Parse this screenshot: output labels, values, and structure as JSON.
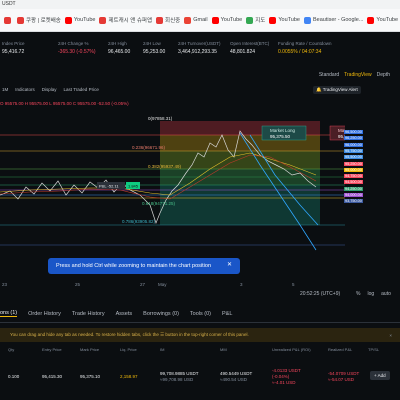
{
  "browser": {
    "tab_title": "USDT",
    "bookmarks": [
      {
        "label": "",
        "icon": "red-square-icon",
        "color": "#e53935"
      },
      {
        "label": "쿠팡 | 로켓배송",
        "icon": "coupang-icon",
        "color": "#e53935"
      },
      {
        "label": "YouTube",
        "icon": "youtube-icon",
        "color": "#ff0000"
      },
      {
        "label": "제트캐시 앤 슈퍼앱",
        "icon": "zcash-icon",
        "color": "#e53935"
      },
      {
        "label": "회신중",
        "icon": "message-icon",
        "color": "#e53935"
      },
      {
        "label": "Gmail",
        "icon": "gmail-icon",
        "color": "#ea4335"
      },
      {
        "label": "YouTube",
        "icon": "youtube-icon",
        "color": "#ff0000"
      },
      {
        "label": "지도",
        "icon": "maps-icon",
        "color": "#34a853"
      },
      {
        "label": "YouTube",
        "icon": "youtube-icon",
        "color": "#ff0000"
      },
      {
        "label": "Beautiser - Google...",
        "icon": "google-icon",
        "color": "#4285f4"
      },
      {
        "label": "YouTube",
        "icon": "youtube-icon",
        "color": "#ff0000"
      },
      {
        "label": "지도",
        "icon": "maps-icon",
        "color": "#34a853"
      },
      {
        "label": "Ayoshi",
        "icon": "bookmark-icon",
        "color": "#e53935"
      }
    ]
  },
  "stats": [
    {
      "label": "Index Price",
      "value": "95,416.72"
    },
    {
      "label": "24H Change %",
      "value": "-365.30 (-0.57%)",
      "color": "#f6465d"
    },
    {
      "label": "24H High",
      "value": "96,465.00"
    },
    {
      "label": "24H Low",
      "value": "95,253.00"
    },
    {
      "label": "24H Turnover(USDT)",
      "value": "3,464,912,293.35"
    },
    {
      "label": "Open Interest(BTC)",
      "value": "48,801.824"
    },
    {
      "label": "Funding Rate / Countdown",
      "value": "0.0055% / 04:07:34",
      "color": "#f0b90b"
    }
  ],
  "view_tabs": [
    "Standard",
    "TradingView",
    "Depth"
  ],
  "chart_toolbar": {
    "interval": "1M",
    "indicators": "Indicators",
    "display": "Display",
    "last_traded": "Last Traded Price",
    "tv_alert": "TradingView Alert"
  },
  "ohlc": "O 95575.00 H 95575.00 L 95575.00 C 95575.00 -52.50 (-0.05%)",
  "chart": {
    "fib_labels": [
      "0(97858.31)",
      "0.236(96671.96)",
      "0.382(95937.49)",
      "0.618(94771.25)",
      "0.786(93905.82)"
    ],
    "market_long": {
      "title": "Market Long",
      "value": "95,375.50"
    },
    "market_short": {
      "title": "Market Short",
      "value": "95,375.00"
    },
    "pl_label": "P&L  -52.11",
    "pl_value": "1.845",
    "price_tags": [
      "96,500.00",
      "96,250.00",
      "96,000.00",
      "95,750.00",
      "95,500.00",
      "95,250.00",
      "95,000.00",
      "94,750.00",
      "94,500.00",
      "94,250.00",
      "94,000.00",
      "93,750.00"
    ],
    "time_axis": [
      "23",
      "25",
      "27",
      "May",
      "3",
      "5"
    ],
    "clock": "20:52:25 (UTC+9)",
    "clock_opts": [
      "%",
      "log",
      "auto"
    ]
  },
  "tooltip": "Press and hold Ctrl while zooming to maintain the chart position",
  "bottom_tabs": [
    "ons (1)",
    "Order History",
    "Trade History",
    "Assets",
    "Borrowings (0)",
    "Tools (0)",
    "P&L"
  ],
  "hint": {
    "text": "You can drag and hide any tab as needed. To restore hidden tabs, click the  ☰  button in the top-right corner of this panel.",
    "close": "×"
  },
  "table": {
    "headers": [
      "Qty",
      "Entry Price",
      "Mark Price",
      "Liq. Price",
      "IM",
      "MM",
      "Unrealized P&L (ROI)",
      "Realized P&L",
      "TP/SL"
    ],
    "row": {
      "qty": "0.100",
      "entry": "95,415.30",
      "mark": "95,375.10",
      "liq": "2,158.97",
      "im": "99,708.9885 USDT",
      "im2": "≈99,708.98 USD",
      "mm": "490.5449 USDT",
      "mm2": "≈490.54 USD",
      "upl": "-4.0133 USDT",
      "upl2": "(-0.04%)",
      "upl3": "≈-4.01 USD",
      "rpl": "-54.0709 USDT",
      "rpl2": "≈-54.07 USD",
      "add": "+ Add"
    }
  }
}
